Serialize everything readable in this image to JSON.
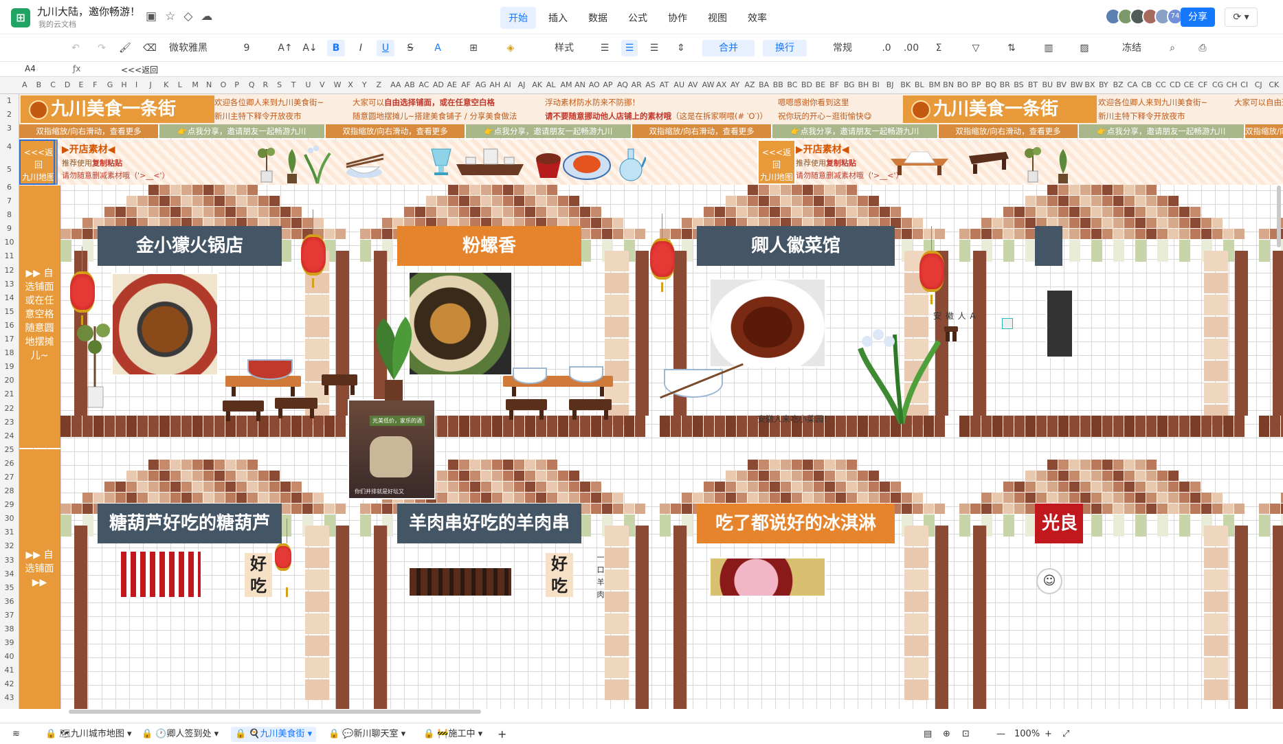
{
  "app": {
    "title": "九川大陆，邀你畅游！",
    "location": "我的云文档",
    "logo_glyph": "⊞"
  },
  "menu": {
    "items": [
      "开始",
      "插入",
      "数据",
      "公式",
      "协作",
      "视图",
      "效率"
    ],
    "active": "开始"
  },
  "header_right": {
    "collaborator_count": "74",
    "share_label": "分享",
    "history_label": "⟳ ▾"
  },
  "toolbar": {
    "undo": "↶",
    "redo": "↷",
    "format_painter": "🖌",
    "clear": "⌫",
    "font_name": "微软雅黑",
    "font_size": "9",
    "grow": "A↑",
    "shrink": "A↓",
    "bold": "B",
    "italic": "I",
    "underline": "U",
    "strike": "S",
    "font_color": "A",
    "border": "⊞",
    "fill": "◈",
    "style_label": "样式",
    "align_left": "☰",
    "align_center": "☰",
    "align_right": "☰",
    "valign": "⇕",
    "merge_label": "合并",
    "wrap_label": "换行",
    "number_format": "常规",
    "freeze_label": "冻结"
  },
  "formula_bar": {
    "cell_ref": "A4",
    "fx": "ƒx",
    "value": "<<<返回"
  },
  "columns": [
    "A",
    "B",
    "C",
    "D",
    "E",
    "F",
    "G",
    "H",
    "I",
    "J",
    "K",
    "L",
    "M",
    "N",
    "O",
    "P",
    "Q",
    "R",
    "S",
    "T",
    "U",
    "V",
    "W",
    "X",
    "Y",
    "Z",
    "AA",
    "AB",
    "AC",
    "AD",
    "AE",
    "AF",
    "AG",
    "AH",
    "AI",
    "AJ",
    "AK",
    "AL",
    "AM",
    "AN",
    "AO",
    "AP",
    "AQ",
    "AR",
    "AS",
    "AT",
    "AU",
    "AV",
    "AW",
    "AX",
    "AY",
    "AZ",
    "BA",
    "BB",
    "BC",
    "BD",
    "BE",
    "BF",
    "BG",
    "BH",
    "BI",
    "BJ",
    "BK",
    "BL",
    "BM",
    "BN",
    "BO",
    "BP",
    "BQ",
    "BR",
    "BS",
    "BT",
    "BU",
    "BV",
    "BW",
    "BX",
    "BY",
    "BZ",
    "CA",
    "CB",
    "CC",
    "CD",
    "CE",
    "CF",
    "CG",
    "CH",
    "CI",
    "CJ",
    "CK"
  ],
  "rows": [
    "1",
    "2",
    "3",
    "4",
    "5",
    "6",
    "7",
    "8",
    "9",
    "10",
    "11",
    "12",
    "13",
    "14",
    "15",
    "16",
    "17",
    "18",
    "19",
    "20",
    "21",
    "22",
    "23",
    "24",
    "25",
    "26",
    "27",
    "28",
    "29",
    "30",
    "31",
    "32",
    "33",
    "34",
    "35",
    "36",
    "37",
    "38",
    "39",
    "40",
    "41",
    "42",
    "43"
  ],
  "banner": {
    "title": "九川美食一条街",
    "welcome_1": "欢迎各位卿人来到九川美食街~",
    "welcome_2": "新川主特下释令开放夜市",
    "notice_1_pre": "大家可以",
    "notice_1_bold": "自由选择铺面，或在任意空白格",
    "notice_2": "随意圆地摆摊儿~搭建美食铺子 / 分享美食做法",
    "float_1": "浮动素材防水防来不防挪！",
    "float_2": "请不要随意挪动他人店铺上的素材哦",
    "float_2_tail": "（这是在拆家啊喂(# ‵O′)）",
    "thanks_1": "嗯嗯感谢你看到这里",
    "thanks_2": "祝你玩的开心~逛街愉快😋",
    "welcome_repeat": "欢迎各位卿人来到九川美食街~",
    "notice_repeat": "大家可以自由选"
  },
  "nav_strip": {
    "scroll_hint": "双指缩放/向右滑动，查看更多",
    "share_hint": "👉点我分享，邀请朋友一起畅游九川"
  },
  "materials": {
    "back_line1": "<<<返回",
    "back_line2": "九川地图",
    "title": "▶开店素材◀",
    "hint_pre": "推荐使用",
    "hint_bold": "复制粘贴",
    "warning": "请勿随意删减素材哦（'>__<'）"
  },
  "sidebar": {
    "block1": "▶▶ 自选铺面或在任意空格随意圆地摆摊儿~",
    "block2": "▶▶ 自选铺面 ▶▶"
  },
  "stores": [
    {
      "name": "金小獴火锅店",
      "style": "slate"
    },
    {
      "name": "粉螺香",
      "style": "orange"
    },
    {
      "name": "卿人徽菜馆",
      "style": "slate"
    },
    {
      "name": "糖葫芦好吃的糖葫芦",
      "style": "slate"
    },
    {
      "name": "羊肉串好吃的羊肉串",
      "style": "slate"
    },
    {
      "name": "吃了都说好的冰淇淋",
      "style": "orange"
    },
    {
      "name": "光良",
      "style": "red"
    }
  ],
  "notes": {
    "anhui_person": "安 徽 人 A",
    "anhui_caption": "安徽人来吃小菜园！",
    "video_caption": "光美低价，家乐的酒",
    "video_sub": "你们并排就是好坛又",
    "good_eat_1": "好吃",
    "good_eat_2": "好吃",
    "side_vertical": "一口羊肉"
  },
  "sheet_tabs": [
    {
      "label": "🔒 🗺九川城市地图 ▾",
      "active": false
    },
    {
      "label": "🔒 🕐卿人签到处 ▾",
      "active": false
    },
    {
      "label": "🔒 🍳九川美食街 ▾",
      "active": true
    },
    {
      "label": "🔒 💬新川聊天室 ▾",
      "active": false
    },
    {
      "label": "🔒 🚧施工中 ▾",
      "active": false
    }
  ],
  "status": {
    "add_sheet": "+",
    "zoom": "100%",
    "zoom_out": "—",
    "zoom_in": "+"
  },
  "colors": {
    "accent": "#1677ff",
    "banner_orange": "#e89a3a",
    "brick_dark": "#8b4a34",
    "brick_mid": "#c58a6b",
    "brick_light": "#e8c9b0",
    "sage": "#c8d5a8"
  }
}
